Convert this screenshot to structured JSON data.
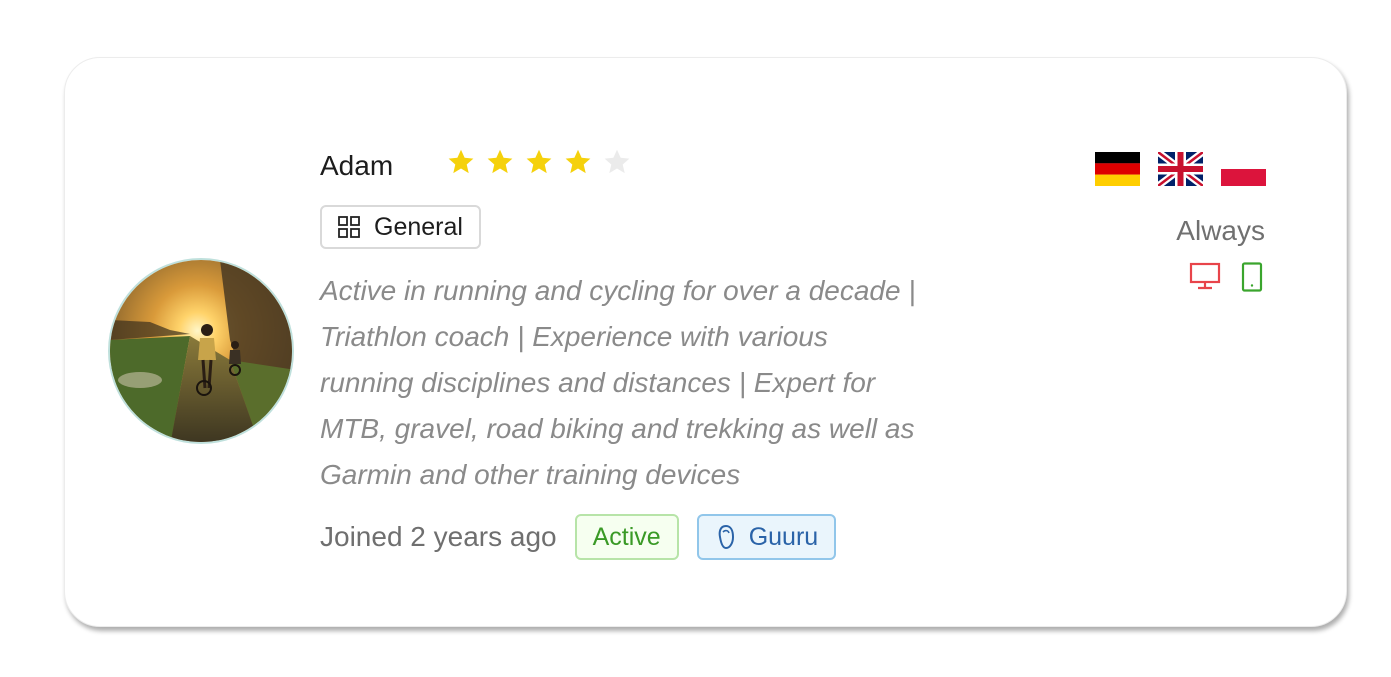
{
  "expert": {
    "name": "Adam",
    "rating": 4,
    "rating_max": 5,
    "category": "General",
    "bio": "Active in running and cycling for over a decade |\nTriathlon coach | Experience with various\nrunning disciplines and distances | Expert for\nMTB, gravel, road biking and trekking as well as\nGarmin and other training devices",
    "joined": "Joined 2 years ago",
    "status_badge": "Active",
    "role_badge": "Guuru",
    "languages": [
      "German",
      "English (UK)",
      "Polish"
    ],
    "availability": "Always",
    "devices": [
      "desktop-icon",
      "mobile-icon"
    ]
  },
  "colors": {
    "star_filled": "#f5d10c",
    "star_empty": "#ebebeb",
    "active_text": "#3a9a26",
    "guuru_text": "#2a63a8",
    "desktop_icon": "#e8444a",
    "mobile_icon": "#3aa52d"
  }
}
